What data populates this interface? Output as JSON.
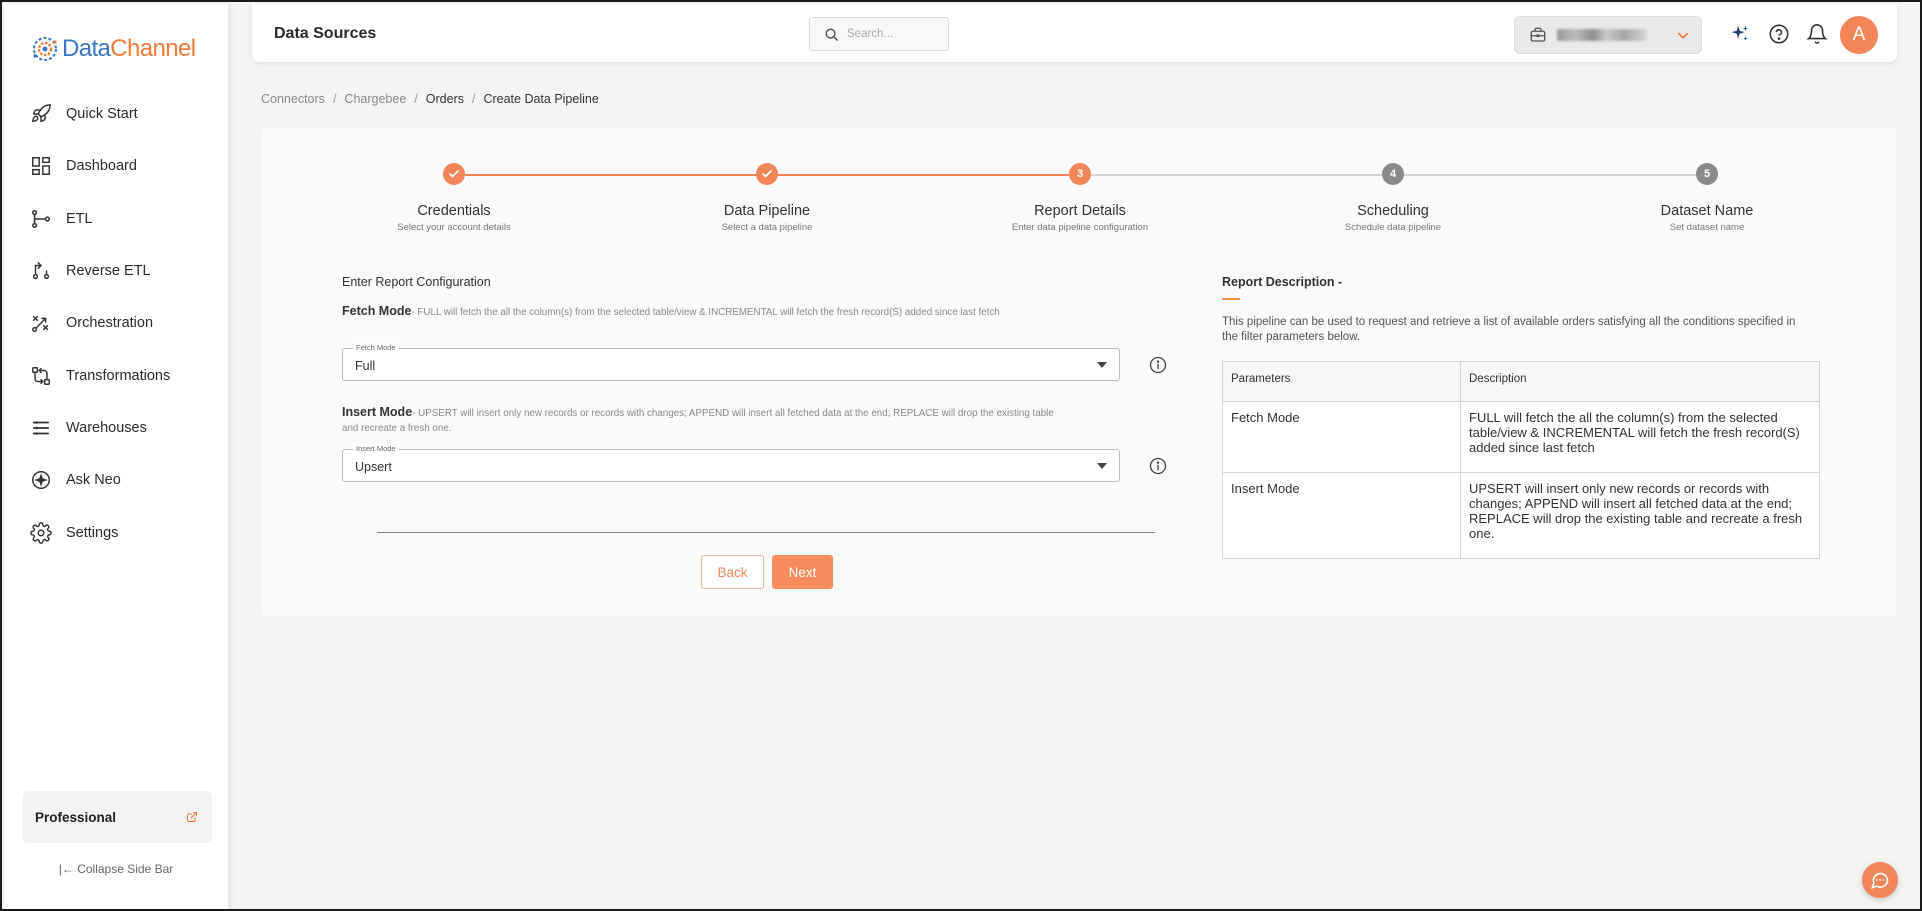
{
  "app": {
    "logo_part1": "Data",
    "logo_part2": "Channel"
  },
  "sidebar": {
    "items": [
      {
        "label": "Quick Start",
        "icon": "rocket-icon"
      },
      {
        "label": "Dashboard",
        "icon": "dashboard-icon"
      },
      {
        "label": "ETL",
        "icon": "etl-icon"
      },
      {
        "label": "Reverse ETL",
        "icon": "reverse-etl-icon"
      },
      {
        "label": "Orchestration",
        "icon": "orchestration-icon"
      },
      {
        "label": "Transformations",
        "icon": "transformations-icon"
      },
      {
        "label": "Warehouses",
        "icon": "warehouses-icon"
      },
      {
        "label": "Ask Neo",
        "icon": "ask-neo-icon"
      },
      {
        "label": "Settings",
        "icon": "gear-icon"
      }
    ],
    "plan_label": "Professional",
    "collapse_label": "Collapse Side Bar"
  },
  "header": {
    "title": "Data Sources",
    "search_placeholder": "Search...",
    "avatar_initial": "A"
  },
  "breadcrumb": {
    "items": [
      "Connectors",
      "Chargebee",
      "Orders",
      "Create Data Pipeline"
    ]
  },
  "stepper": {
    "steps": [
      {
        "title": "Credentials",
        "subtitle": "Select your account details",
        "state": "done"
      },
      {
        "title": "Data Pipeline",
        "subtitle": "Select a data pipeline",
        "state": "done"
      },
      {
        "title": "Report Details",
        "subtitle": "Enter data pipeline configuration",
        "state": "active",
        "number": "3"
      },
      {
        "title": "Scheduling",
        "subtitle": "Schedule data pipeline",
        "state": "pending",
        "number": "4"
      },
      {
        "title": "Dataset Name",
        "subtitle": "Set dataset name",
        "state": "pending",
        "number": "5"
      }
    ]
  },
  "form": {
    "section_title": "Enter Report Configuration",
    "fetch_mode": {
      "heading": "Fetch Mode",
      "description": "- FULL will fetch the all the column(s) from the selected table/view & INCREMENTAL will fetch the fresh record(S) added since last fetch",
      "legend": "Fetch Mode",
      "value": "Full"
    },
    "insert_mode": {
      "heading": "Insert Mode",
      "description": "- UPSERT will insert only new records or records with changes; APPEND will insert all fetched data at the end; REPLACE will drop the existing table and recreate a fresh one.",
      "legend": "Insert Mode",
      "value": "Upsert"
    },
    "back_label": "Back",
    "next_label": "Next"
  },
  "report_description": {
    "title": "Report Description -",
    "text": "This pipeline can be used to request and retrieve a list of available orders satisfying all the conditions specified in the filter parameters below.",
    "table": {
      "headers": [
        "Parameters",
        "Description"
      ],
      "rows": [
        [
          "Fetch Mode",
          "FULL will fetch the all the column(s) from the selected table/view & INCREMENTAL will fetch the fresh record(S) added since last fetch"
        ],
        [
          "Insert Mode",
          "UPSERT will insert only new records or records with changes; APPEND will insert all fetched data at the end; REPLACE will drop the existing table and recreate a fresh one."
        ]
      ]
    }
  },
  "colors": {
    "accent": "#f68c5d",
    "step_done": "#f38659",
    "step_pending": "#8a8a8a",
    "brand_blue": "#3a76c4",
    "brand_orange": "#ef7a3a"
  }
}
